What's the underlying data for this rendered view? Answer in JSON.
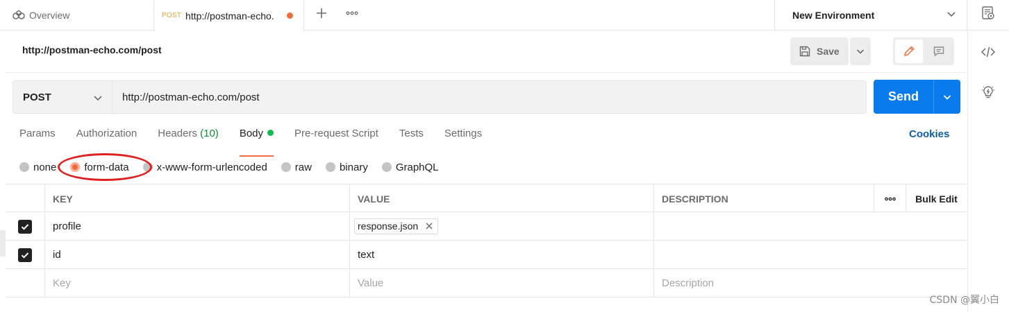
{
  "tabs": {
    "overview": {
      "label": "Overview",
      "icon": "overview-icon"
    },
    "active": {
      "method": "POST",
      "url": "http://postman-echo.",
      "unsaved_dot_color": "#f26b3a"
    }
  },
  "environment": {
    "label": "New Environment"
  },
  "request": {
    "title": "http://postman-echo.com/post",
    "method": "POST",
    "url": "http://postman-echo.com/post"
  },
  "toolbar": {
    "save_label": "Save",
    "send_label": "Send"
  },
  "subtabs": {
    "params": "Params",
    "authorization": "Authorization",
    "headers": "Headers",
    "headers_count": "(10)",
    "body": "Body",
    "prerequest": "Pre-request Script",
    "tests": "Tests",
    "settings": "Settings",
    "cookies": "Cookies",
    "active": "Body"
  },
  "body_types": {
    "none": "none",
    "form_data": "form-data",
    "urlencoded": "x-www-form-urlencoded",
    "raw": "raw",
    "binary": "binary",
    "graphql": "GraphQL",
    "selected": "form-data"
  },
  "table": {
    "headers": {
      "key": "KEY",
      "value": "VALUE",
      "description": "DESCRIPTION",
      "bulk_edit": "Bulk Edit"
    },
    "rows": [
      {
        "checked": true,
        "key": "profile",
        "value": "response.json",
        "value_type": "file",
        "description": ""
      },
      {
        "checked": true,
        "key": "id",
        "value": "text",
        "value_type": "text",
        "description": ""
      }
    ],
    "placeholders": {
      "key": "Key",
      "value": "Value",
      "description": "Description"
    }
  },
  "watermark": "CSDN @翼小白",
  "colors": {
    "accent": "#f26b3a",
    "send": "#097bed",
    "link": "#0d5ea6",
    "annotation": "#e02020"
  }
}
